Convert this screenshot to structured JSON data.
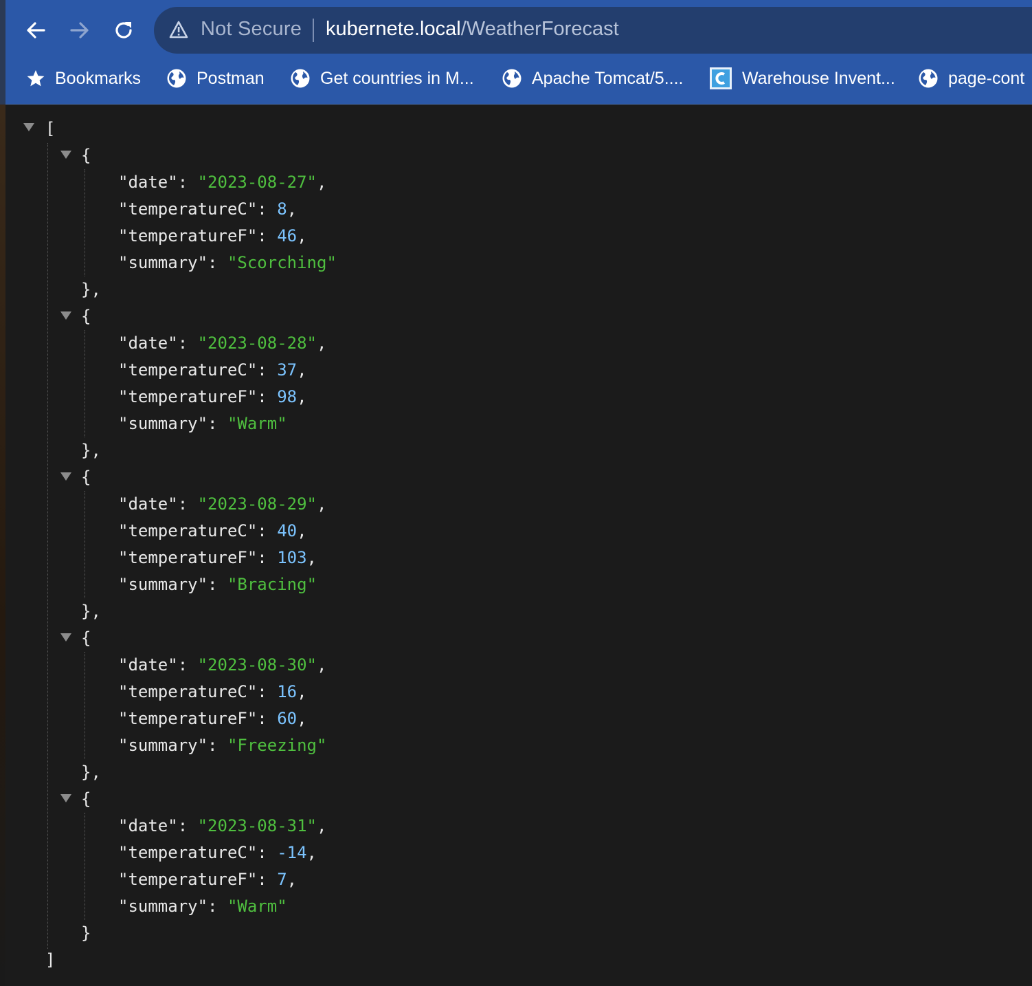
{
  "browser": {
    "security_label": "Not Secure",
    "url_host": "kubernete.local",
    "url_path": "/WeatherForecast"
  },
  "bookmarks": [
    {
      "label": "Bookmarks",
      "icon": "star-icon"
    },
    {
      "label": "Postman",
      "icon": "globe-icon"
    },
    {
      "label": "Get countries in M...",
      "icon": "globe-icon"
    },
    {
      "label": "Apache Tomcat/5....",
      "icon": "globe-icon"
    },
    {
      "label": "Warehouse Invent...",
      "icon": "app-icon"
    },
    {
      "label": "page-cont",
      "icon": "globe-icon"
    }
  ],
  "json": {
    "open_bracket": "[",
    "close_bracket": "]",
    "records": [
      {
        "date": "2023-08-27",
        "temperatureC": "8",
        "temperatureF": "46",
        "summary": "Scorching"
      },
      {
        "date": "2023-08-28",
        "temperatureC": "37",
        "temperatureF": "98",
        "summary": "Warm"
      },
      {
        "date": "2023-08-29",
        "temperatureC": "40",
        "temperatureF": "103",
        "summary": "Bracing"
      },
      {
        "date": "2023-08-30",
        "temperatureC": "16",
        "temperatureF": "60",
        "summary": "Freezing"
      },
      {
        "date": "2023-08-31",
        "temperatureC": "-14",
        "temperatureF": "7",
        "summary": "Warm"
      }
    ]
  },
  "colors": {
    "toolbar": "#2b58a8",
    "viewer_bg": "#1b1b1b",
    "string": "#4fbf3f",
    "number": "#7cc4ff"
  }
}
